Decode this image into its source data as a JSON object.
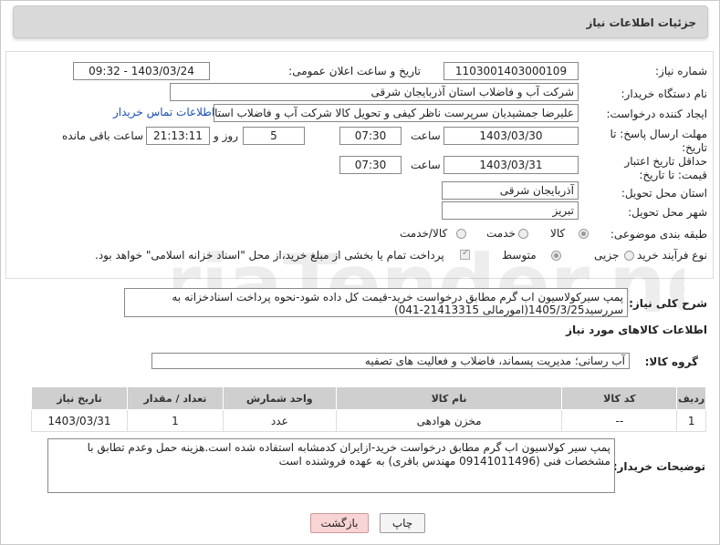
{
  "header": {
    "title": "جزئیات اطلاعات نیاز"
  },
  "form": {
    "need_number_label": "شماره نیاز:",
    "need_number": "1103001403000109",
    "announce_label": "تاریخ و ساعت اعلان عمومی:",
    "announce_value": "1403/03/24 - 09:32",
    "buyer_org_label": "نام دستگاه خریدار:",
    "buyer_org": "شرکت آب و فاضلاب استان آذربایجان شرقی",
    "requester_label": "ایجاد کننده درخواست:",
    "requester": "علیرضا جمشیدیان سرپرست ناظر کیفی و تحویل کالا شرکت آب و فاضلاب استان",
    "buyer_contact_link": "اطلاعات تماس خریدار",
    "reply_deadline_label": "مهلت ارسال پاسخ: تا تاریخ:",
    "reply_date": "1403/03/30",
    "time_label": "ساعت",
    "reply_time": "07:30",
    "days_value": "5",
    "days_label": "روز و",
    "remaining_time": "21:13:11",
    "remaining_label": "ساعت باقی مانده",
    "price_validity_label": "حداقل تاریخ اعتبار قیمت: تا تاریخ:",
    "price_date": "1403/03/31",
    "price_time": "07:30",
    "province_label": "استان محل تحویل:",
    "province": "آذربایجان شرقی",
    "city_label": "شهر محل تحویل:",
    "city": "تبریز",
    "category_label": "طبقه بندی موضوعی:",
    "category_options": [
      "کالا",
      "خدمت",
      "کالا/خدمت"
    ],
    "process_label": "نوع فرآیند خرید :",
    "process_options": [
      "جزیی",
      "متوسط"
    ],
    "payment_note": "پرداخت تمام یا بخشی از مبلغ خرید،از محل \"اسناد خزانه اسلامی\" خواهد بود."
  },
  "general_desc": {
    "label": "شرح کلی نیاز:",
    "line1": "پمپ سیرکولاسیون اب گرم مطابق درخواست خرید-قیمت کل داده شود-نحوه پرداخت اسنادخزانه به",
    "line2": "سررسید1405/3/25(امورمالی 21413315-041)"
  },
  "goods_section": {
    "title": "اطلاعات کالاهای مورد نیاز",
    "group_label": "گروه کالا:",
    "group_value": "آب رسانی؛ مدیریت پسماند، فاضلاب و فعالیت های تصفیه"
  },
  "table": {
    "headers": [
      "ردیف",
      "کد کالا",
      "نام کالا",
      "واحد شمارش",
      "تعداد / مقدار",
      "تاریخ نیاز"
    ],
    "rows": [
      {
        "row": "1",
        "code": "--",
        "name": "مخزن هوادهی",
        "unit": "عدد",
        "qty": "1",
        "date": "1403/03/31"
      }
    ]
  },
  "buyer_desc": {
    "label": "توضیحات خریدار:",
    "line1": "پمپ سیر کولاسیون  اب گرم مطابق درخواست خرید-ازایران کدمشابه استفاده شده است.هزینه حمل وعدم تطابق با",
    "line2": "مشخصات فنی (09141011496 مهندس باقری) به عهده فروشنده است"
  },
  "buttons": {
    "print": "چاپ",
    "back": "بازگشت"
  },
  "watermark": "AriaTender.net"
}
